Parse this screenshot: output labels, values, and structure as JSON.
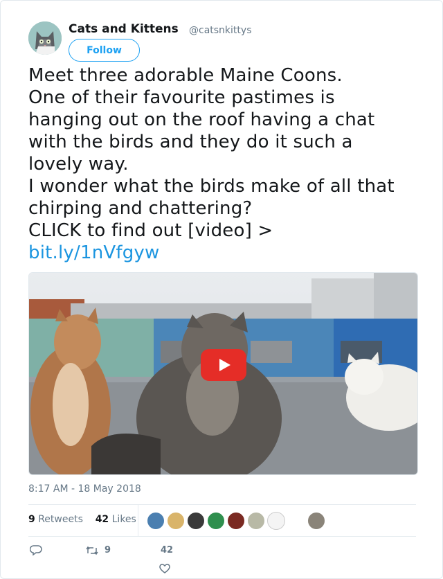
{
  "author": {
    "name": "Cats and Kittens",
    "handle": "@catsnkittys",
    "follow_label": "Follow",
    "avatar_icon": "cat-avatar-icon"
  },
  "tweet": {
    "lines": [
      "Meet three adorable Maine Coons.",
      "One of their favourite pastimes is",
      "hanging out on the roof having a chat",
      "with the birds and they do it such a",
      "lovely way.",
      "I wonder what the birds make of all that",
      "chirping and chattering?",
      "CLICK to find out [video] >"
    ],
    "link": "bit.ly/1nVfgyw"
  },
  "media": {
    "type": "video",
    "icon": "play-icon",
    "accent": "#e52d27"
  },
  "timestamp": "8:17 AM - 18 May 2018",
  "stats": {
    "retweets_count": "9",
    "retweets_label": "Retweets",
    "likes_count": "42",
    "likes_label": "Likes"
  },
  "actions": {
    "reply_icon": "reply-icon",
    "retweet_icon": "retweet-icon",
    "retweet_count": "9",
    "like_icon": "heart-icon",
    "like_count": "42"
  },
  "colors": {
    "accent": "#1da1f2",
    "link": "#1b95e0",
    "muted": "#657786"
  }
}
